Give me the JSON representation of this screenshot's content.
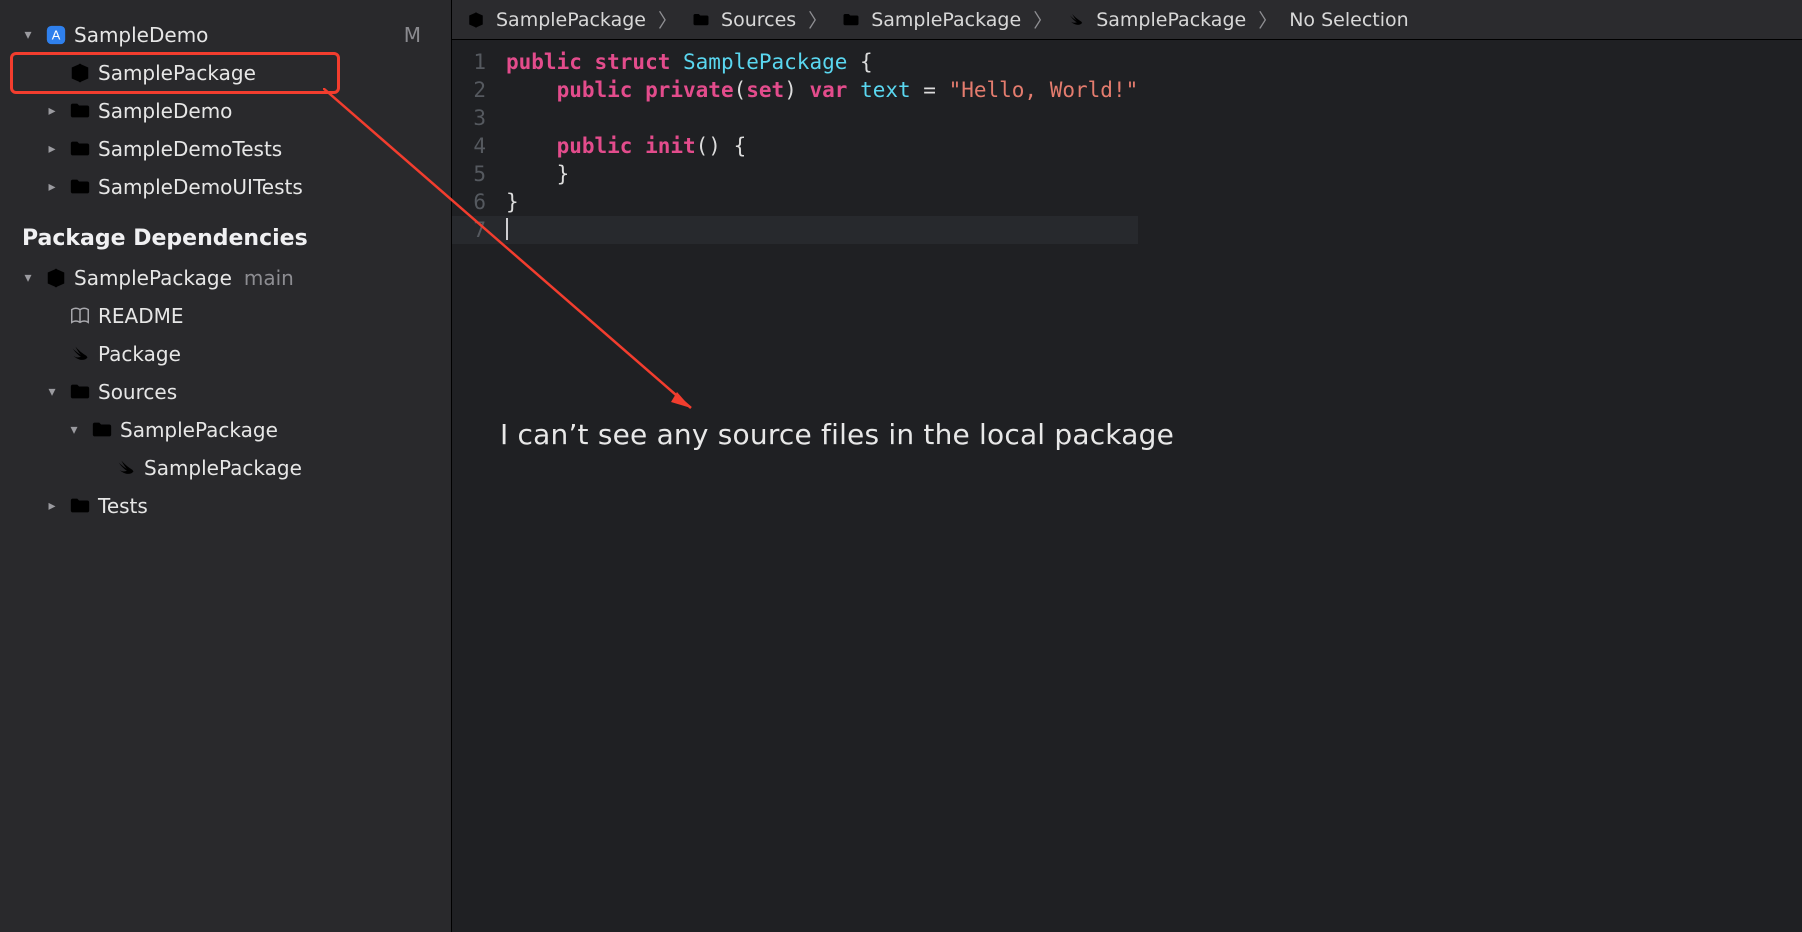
{
  "sidebar": {
    "project": {
      "name": "SampleDemo",
      "status": "M"
    },
    "items": [
      {
        "label": "SamplePackage"
      },
      {
        "label": "SampleDemo"
      },
      {
        "label": "SampleDemoTests"
      },
      {
        "label": "SampleDemoUITests"
      }
    ],
    "deps_section": "Package Dependencies",
    "dep": {
      "name": "SamplePackage",
      "branch": "main",
      "children": {
        "readme": "README",
        "package": "Package",
        "sources": "Sources",
        "sources_child": "SamplePackage",
        "sources_leaf": "SamplePackage",
        "tests": "Tests"
      }
    }
  },
  "crumbs": {
    "c1": "SamplePackage",
    "c2": "Sources",
    "c3": "SamplePackage",
    "c4": "SamplePackage",
    "c5": "No Selection"
  },
  "code": {
    "l1a": "public",
    "l1b": " struct",
    "l1c": " SamplePackage",
    "l1d": " {",
    "l2a": "public",
    "l2b": " private",
    "l2c": "(",
    "l2d": "set",
    "l2e": ") ",
    "l2f": "var",
    "l2g": " text",
    "l2h": " = ",
    "l2i": "\"Hello, World!\"",
    "l4a": "public",
    "l4b": " init",
    "l4c": "() {",
    "l5": "}",
    "l6": "}",
    "nums": {
      "1": "1",
      "2": "2",
      "3": "3",
      "4": "4",
      "5": "5",
      "6": "6",
      "7": "7"
    }
  },
  "annotation": {
    "text": "I can’t see any source files in the local package"
  }
}
